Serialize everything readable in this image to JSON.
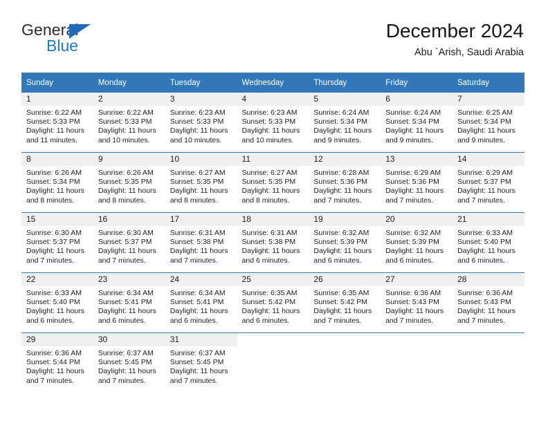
{
  "brand": {
    "name_part1": "General",
    "name_part2": "Blue",
    "triangle_icon": "logo-triangle-icon",
    "colors": {
      "dark": "#2b2b2b",
      "blue": "#1e7ac4",
      "triangle": "#1e6bb8"
    }
  },
  "header": {
    "title": "December 2024",
    "subtitle": "Abu `Arish, Saudi Arabia"
  },
  "theme": {
    "header_blue": "#3277b8",
    "daynum_band": "#f0f0f0",
    "text": "#1c1c1c"
  },
  "weekday_headers": [
    "Sunday",
    "Monday",
    "Tuesday",
    "Wednesday",
    "Thursday",
    "Friday",
    "Saturday"
  ],
  "weeks": [
    {
      "days": [
        {
          "num": "1",
          "sunrise": "Sunrise: 6:22 AM",
          "sunset": "Sunset: 5:33 PM",
          "daylight_line1": "Daylight: 11 hours",
          "daylight_line2": "and 11 minutes."
        },
        {
          "num": "2",
          "sunrise": "Sunrise: 6:22 AM",
          "sunset": "Sunset: 5:33 PM",
          "daylight_line1": "Daylight: 11 hours",
          "daylight_line2": "and 10 minutes."
        },
        {
          "num": "3",
          "sunrise": "Sunrise: 6:23 AM",
          "sunset": "Sunset: 5:33 PM",
          "daylight_line1": "Daylight: 11 hours",
          "daylight_line2": "and 10 minutes."
        },
        {
          "num": "4",
          "sunrise": "Sunrise: 6:23 AM",
          "sunset": "Sunset: 5:33 PM",
          "daylight_line1": "Daylight: 11 hours",
          "daylight_line2": "and 10 minutes."
        },
        {
          "num": "5",
          "sunrise": "Sunrise: 6:24 AM",
          "sunset": "Sunset: 5:34 PM",
          "daylight_line1": "Daylight: 11 hours",
          "daylight_line2": "and 9 minutes."
        },
        {
          "num": "6",
          "sunrise": "Sunrise: 6:24 AM",
          "sunset": "Sunset: 5:34 PM",
          "daylight_line1": "Daylight: 11 hours",
          "daylight_line2": "and 9 minutes."
        },
        {
          "num": "7",
          "sunrise": "Sunrise: 6:25 AM",
          "sunset": "Sunset: 5:34 PM",
          "daylight_line1": "Daylight: 11 hours",
          "daylight_line2": "and 9 minutes."
        }
      ]
    },
    {
      "days": [
        {
          "num": "8",
          "sunrise": "Sunrise: 6:26 AM",
          "sunset": "Sunset: 5:34 PM",
          "daylight_line1": "Daylight: 11 hours",
          "daylight_line2": "and 8 minutes."
        },
        {
          "num": "9",
          "sunrise": "Sunrise: 6:26 AM",
          "sunset": "Sunset: 5:35 PM",
          "daylight_line1": "Daylight: 11 hours",
          "daylight_line2": "and 8 minutes."
        },
        {
          "num": "10",
          "sunrise": "Sunrise: 6:27 AM",
          "sunset": "Sunset: 5:35 PM",
          "daylight_line1": "Daylight: 11 hours",
          "daylight_line2": "and 8 minutes."
        },
        {
          "num": "11",
          "sunrise": "Sunrise: 6:27 AM",
          "sunset": "Sunset: 5:35 PM",
          "daylight_line1": "Daylight: 11 hours",
          "daylight_line2": "and 8 minutes."
        },
        {
          "num": "12",
          "sunrise": "Sunrise: 6:28 AM",
          "sunset": "Sunset: 5:36 PM",
          "daylight_line1": "Daylight: 11 hours",
          "daylight_line2": "and 7 minutes."
        },
        {
          "num": "13",
          "sunrise": "Sunrise: 6:29 AM",
          "sunset": "Sunset: 5:36 PM",
          "daylight_line1": "Daylight: 11 hours",
          "daylight_line2": "and 7 minutes."
        },
        {
          "num": "14",
          "sunrise": "Sunrise: 6:29 AM",
          "sunset": "Sunset: 5:37 PM",
          "daylight_line1": "Daylight: 11 hours",
          "daylight_line2": "and 7 minutes."
        }
      ]
    },
    {
      "days": [
        {
          "num": "15",
          "sunrise": "Sunrise: 6:30 AM",
          "sunset": "Sunset: 5:37 PM",
          "daylight_line1": "Daylight: 11 hours",
          "daylight_line2": "and 7 minutes."
        },
        {
          "num": "16",
          "sunrise": "Sunrise: 6:30 AM",
          "sunset": "Sunset: 5:37 PM",
          "daylight_line1": "Daylight: 11 hours",
          "daylight_line2": "and 7 minutes."
        },
        {
          "num": "17",
          "sunrise": "Sunrise: 6:31 AM",
          "sunset": "Sunset: 5:38 PM",
          "daylight_line1": "Daylight: 11 hours",
          "daylight_line2": "and 7 minutes."
        },
        {
          "num": "18",
          "sunrise": "Sunrise: 6:31 AM",
          "sunset": "Sunset: 5:38 PM",
          "daylight_line1": "Daylight: 11 hours",
          "daylight_line2": "and 6 minutes."
        },
        {
          "num": "19",
          "sunrise": "Sunrise: 6:32 AM",
          "sunset": "Sunset: 5:39 PM",
          "daylight_line1": "Daylight: 11 hours",
          "daylight_line2": "and 6 minutes."
        },
        {
          "num": "20",
          "sunrise": "Sunrise: 6:32 AM",
          "sunset": "Sunset: 5:39 PM",
          "daylight_line1": "Daylight: 11 hours",
          "daylight_line2": "and 6 minutes."
        },
        {
          "num": "21",
          "sunrise": "Sunrise: 6:33 AM",
          "sunset": "Sunset: 5:40 PM",
          "daylight_line1": "Daylight: 11 hours",
          "daylight_line2": "and 6 minutes."
        }
      ]
    },
    {
      "days": [
        {
          "num": "22",
          "sunrise": "Sunrise: 6:33 AM",
          "sunset": "Sunset: 5:40 PM",
          "daylight_line1": "Daylight: 11 hours",
          "daylight_line2": "and 6 minutes."
        },
        {
          "num": "23",
          "sunrise": "Sunrise: 6:34 AM",
          "sunset": "Sunset: 5:41 PM",
          "daylight_line1": "Daylight: 11 hours",
          "daylight_line2": "and 6 minutes."
        },
        {
          "num": "24",
          "sunrise": "Sunrise: 6:34 AM",
          "sunset": "Sunset: 5:41 PM",
          "daylight_line1": "Daylight: 11 hours",
          "daylight_line2": "and 6 minutes."
        },
        {
          "num": "25",
          "sunrise": "Sunrise: 6:35 AM",
          "sunset": "Sunset: 5:42 PM",
          "daylight_line1": "Daylight: 11 hours",
          "daylight_line2": "and 6 minutes."
        },
        {
          "num": "26",
          "sunrise": "Sunrise: 6:35 AM",
          "sunset": "Sunset: 5:42 PM",
          "daylight_line1": "Daylight: 11 hours",
          "daylight_line2": "and 7 minutes."
        },
        {
          "num": "27",
          "sunrise": "Sunrise: 6:36 AM",
          "sunset": "Sunset: 5:43 PM",
          "daylight_line1": "Daylight: 11 hours",
          "daylight_line2": "and 7 minutes."
        },
        {
          "num": "28",
          "sunrise": "Sunrise: 6:36 AM",
          "sunset": "Sunset: 5:43 PM",
          "daylight_line1": "Daylight: 11 hours",
          "daylight_line2": "and 7 minutes."
        }
      ]
    },
    {
      "days": [
        {
          "num": "29",
          "sunrise": "Sunrise: 6:36 AM",
          "sunset": "Sunset: 5:44 PM",
          "daylight_line1": "Daylight: 11 hours",
          "daylight_line2": "and 7 minutes."
        },
        {
          "num": "30",
          "sunrise": "Sunrise: 6:37 AM",
          "sunset": "Sunset: 5:45 PM",
          "daylight_line1": "Daylight: 11 hours",
          "daylight_line2": "and 7 minutes."
        },
        {
          "num": "31",
          "sunrise": "Sunrise: 6:37 AM",
          "sunset": "Sunset: 5:45 PM",
          "daylight_line1": "Daylight: 11 hours",
          "daylight_line2": "and 7 minutes."
        },
        {
          "num": "",
          "sunrise": "",
          "sunset": "",
          "daylight_line1": "",
          "daylight_line2": ""
        },
        {
          "num": "",
          "sunrise": "",
          "sunset": "",
          "daylight_line1": "",
          "daylight_line2": ""
        },
        {
          "num": "",
          "sunrise": "",
          "sunset": "",
          "daylight_line1": "",
          "daylight_line2": ""
        },
        {
          "num": "",
          "sunrise": "",
          "sunset": "",
          "daylight_line1": "",
          "daylight_line2": ""
        }
      ]
    }
  ]
}
